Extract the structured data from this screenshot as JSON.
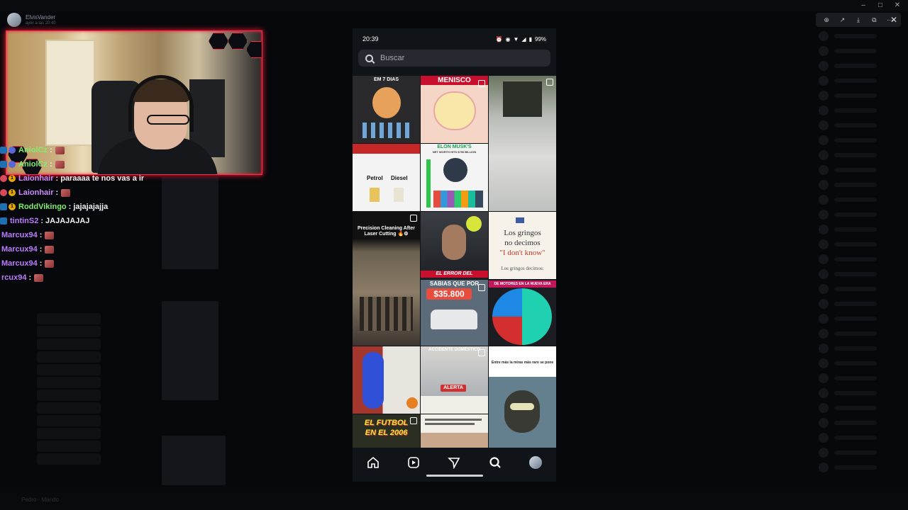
{
  "streamer": {
    "name": "ElvisVander",
    "timestamp": "ayer a las 20:40"
  },
  "viewer_toolbar": {
    "icons": [
      "zoom-in-icon",
      "share-icon",
      "download-icon",
      "open-external-icon",
      "more-icon"
    ],
    "close": "✕"
  },
  "chat": {
    "messages": [
      {
        "user": "AniolCz",
        "color": "#7cf06a",
        "text": "",
        "emote": true,
        "badges": [
          "prime",
          "circle"
        ]
      },
      {
        "user": "AniolCz",
        "color": "#7cf06a",
        "text": "",
        "emote": true,
        "badges": [
          "prime",
          "circle"
        ]
      },
      {
        "user": "Laionhair",
        "color": "#c98cff",
        "text": "paraaaa te nos vas a ir",
        "emote": false,
        "badges": [
          "red",
          "gold"
        ]
      },
      {
        "user": "Laionhair",
        "color": "#c98cff",
        "text": "",
        "emote": true,
        "badges": [
          "red",
          "gold"
        ]
      },
      {
        "user": "RoddVikingo",
        "color": "#7cf06a",
        "text": "jajajajajja",
        "emote": false,
        "badges": [
          "prime",
          "gold"
        ]
      },
      {
        "user": "tintinS2",
        "color": "#b97cff",
        "text": "JAJAJAJAJ",
        "emote": false,
        "badges": [
          "prime"
        ]
      },
      {
        "user": "Marcux94",
        "color": "#b97cff",
        "text": "",
        "emote": true,
        "badges": []
      },
      {
        "user": "Marcux94",
        "color": "#b97cff",
        "text": "",
        "emote": true,
        "badges": []
      },
      {
        "user": "Marcux94",
        "color": "#b97cff",
        "text": "",
        "emote": true,
        "badges": []
      },
      {
        "user": "rcux94",
        "color": "#b97cff",
        "text": "",
        "emote": true,
        "badges": []
      }
    ]
  },
  "phone": {
    "time": "20:39",
    "battery": "99%",
    "search_placeholder": "Buscar",
    "tiles": {
      "t1": {
        "title": "EM 7 DIAS"
      },
      "t2": {
        "title": "MENISCO"
      },
      "t4": {
        "label_a": "Petrol",
        "label_b": "Diesel"
      },
      "t5": {
        "title": "ELON MUSK'S",
        "subtitle": "NET WORTH HITS $750 BILLION"
      },
      "t7": {
        "title": "Precision Cleaning After Laser Cutting 🔥⚙"
      },
      "t8": {
        "banner": "EL ERROR DEL"
      },
      "t9": {
        "line1": "Los gringos",
        "line2": "no decimos",
        "quote": "\"I don't know\"",
        "sub": "Los gringos decimos:"
      },
      "t10": {
        "title": "SABIAS QUE POR",
        "price": "$35.800"
      },
      "t11": {
        "title": "DE MOTORES EN LA NUEVA ERA"
      },
      "t13": {
        "title": "ACCIDENTE DOMÉSTICO",
        "tag": "ALERTA"
      },
      "t14": {
        "title": "Entre más la miras más raro se pone"
      },
      "t15": {
        "line1": "EL FUTBOL",
        "line2": "EN EL 2006"
      }
    },
    "nav": [
      "home-icon",
      "reels-icon",
      "send-icon",
      "search-icon",
      "profile-avatar"
    ]
  },
  "background": {
    "bottom_user": "Pedro · Mando"
  },
  "colors": {
    "webcam_border": "#ff2b47",
    "phone_bg": "#101317",
    "search_bg": "#262a30"
  }
}
